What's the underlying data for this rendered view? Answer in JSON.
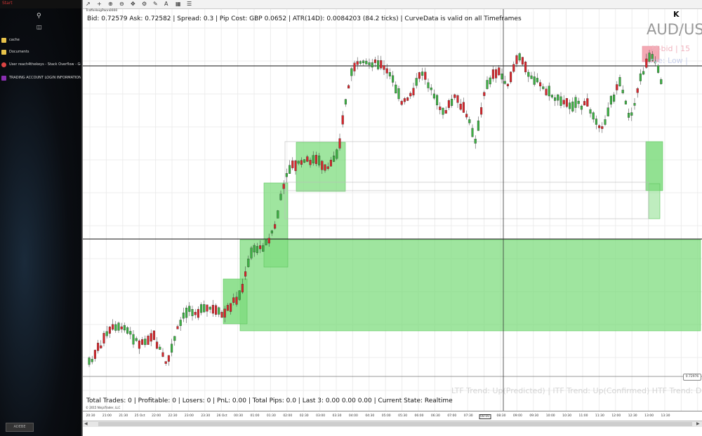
{
  "taskbar": {
    "start_label": "Start",
    "item_label": "ADEBE"
  },
  "desktop_items": [
    {
      "label": "cache",
      "icon": "folder-icon",
      "color": "#e8c34a"
    },
    {
      "label": "Documents",
      "icon": "folder-icon",
      "color": "#e8c34a"
    },
    {
      "label": "User reach4thekeys - Stack Overflow - Goog...",
      "icon": "chrome-icon",
      "color": "#d44"
    },
    {
      "label": "TRADING ACCOUNT LOGIN INFORMATION -...",
      "icon": "onenote-icon",
      "color": "#8a2fb0"
    }
  ],
  "chart": {
    "window_label": "TraffeHeigPann0000",
    "bid_info": "Bid: 0.72579 Ask: 0.72582 | Spread: 0.3 | Pip Cost: GBP 0.0652 | ATR(14D): 0.0084203 (84.2 ticks) | CurveData is valid on all Timeframes",
    "symbol": "AUD/US",
    "feed_line1": "M-bid | 15",
    "feed_line2": "rve: Low |",
    "trend_line": "LTF Trend: Up(Predicted) | ITF Trend: Up(Confirmed) HTF Trend: D",
    "stats_line": "Total Trades: 0 | Profitable: 0 | Losers: 0 | PnL: 0.00 | Total Pips: 0.0 | Last 3: 0.00 0.00 0.00 | Current State: Realtime",
    "copyright": "© 2015 NinjaTrader, LLC",
    "price_tag": "0.72976",
    "time_ticks": [
      "20:30",
      "21:00",
      "21:30",
      "25 Oct",
      "22:00",
      "22:30",
      "23:00",
      "23:30",
      "26 Oct",
      "00:30",
      "01:00",
      "01:30",
      "02:00",
      "02:30",
      "03:00",
      "03:30",
      "04:00",
      "04:30",
      "05:00",
      "05:30",
      "06:00",
      "06:30",
      "07:00",
      "07:30",
      "08:00",
      "08:30",
      "09:00",
      "09:30",
      "10:00",
      "10:30",
      "11:00",
      "11:30",
      "12:00",
      "12:30",
      "13:00",
      "13:30"
    ],
    "highlighted_tick": "08:00",
    "colors": {
      "up": "#3cb043",
      "down": "#d7262c",
      "zone": "#7fdc7f",
      "supply": "#f4a9b4"
    }
  }
}
